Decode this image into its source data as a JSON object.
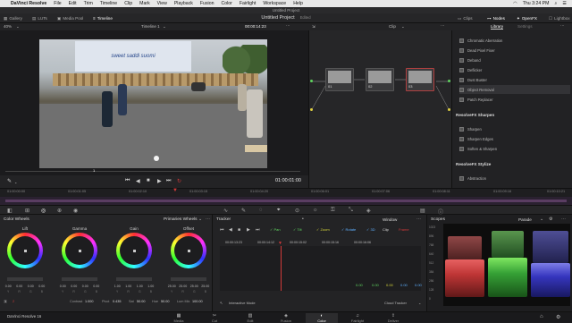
{
  "menubar": {
    "app": "DaVinci Resolve",
    "items": [
      "File",
      "Edit",
      "Trim",
      "Timeline",
      "Clip",
      "Mark",
      "View",
      "Playback",
      "Fusion",
      "Color",
      "Fairlight",
      "Workspace",
      "Help"
    ],
    "clock": "Thu 3:24 PM"
  },
  "window": {
    "title": "Untitled Project"
  },
  "toptabs": {
    "gallery": "Gallery",
    "luts": "LUTs",
    "media_pool": "Media Pool",
    "timeline": "Timeline",
    "clips": "Clips",
    "nodes": "Nodes",
    "openfx": "OpenFX",
    "lightbox": "Lightbox"
  },
  "project": {
    "title": "Untitled Project",
    "status": "Edited"
  },
  "viewer": {
    "zoom": "40%",
    "timeline_name": "Timeline 1",
    "header_timecode": "00:00:14:23",
    "clip_label": "Clip",
    "timecode": "01:00:01:00",
    "marker": "1",
    "screen_text": "sweet saddi suomi"
  },
  "nodes": {
    "n1": "01",
    "n2": "02",
    "n3": "03"
  },
  "library": {
    "tab": "Library",
    "settings": "Settings",
    "items_a": [
      "Chromatic Aberration",
      "Dead Pixel Fixer",
      "Deband",
      "Deflicker",
      "Dust Buster",
      "Object Removal",
      "Patch Replacer"
    ],
    "head_sharpen": "ResolveFX Sharpen",
    "items_b": [
      "Sharpen",
      "Sharpen Edges",
      "Soften & Sharpen"
    ],
    "head_stylize": "ResolveFX Stylize",
    "items_c": [
      "Abstraction"
    ]
  },
  "ruler": {
    "ticks": [
      "01:00:00:00",
      "01:00:01:05",
      "01:00:02:10",
      "01:00:03:15",
      "01:00:04:20",
      "01:00:06:01",
      "01:00:07:06",
      "01:00:08:11",
      "01:00:09:16",
      "01:00:10:21"
    ]
  },
  "wheels": {
    "title": "Color Wheels",
    "mode": "Primaries Wheels",
    "lift": {
      "label": "Lift",
      "vals": [
        "0.00",
        "0.00",
        "0.00",
        "0.00"
      ]
    },
    "gamma": {
      "label": "Gamma",
      "vals": [
        "0.00",
        "0.00",
        "0.00",
        "0.00"
      ]
    },
    "gain": {
      "label": "Gain",
      "vals": [
        "1.00",
        "1.00",
        "1.00",
        "1.00"
      ]
    },
    "offset": {
      "label": "Offset",
      "vals": [
        "25.00",
        "25.00",
        "25.00",
        "25.00"
      ]
    },
    "sub": [
      "Y",
      "R",
      "G",
      "B"
    ],
    "contrast_label": "Contrast",
    "contrast": "1.000",
    "pivot_label": "Pivot",
    "pivot": "0.435",
    "sat_label": "Sat",
    "sat": "50.00",
    "hue_label": "Hue",
    "hue": "50.00",
    "lummix_label": "Lum Mix",
    "lummix": "100.00"
  },
  "tracker": {
    "title": "Tracker",
    "window": "Window",
    "clip": "Clip",
    "frame": "Frame",
    "options": [
      "Pan",
      "Tilt",
      "Zoom",
      "Rotate",
      "3D"
    ],
    "times": [
      "00:00:13:23",
      "00:00:14:12",
      "00:00:15:02",
      "00:00:15:16",
      "00:00:16:06"
    ],
    "vals": [
      "0.00",
      "0.00",
      "0.00",
      "0.00",
      "0.00"
    ],
    "mode": "Interactive Mode",
    "tracker_type": "Cloud Tracker"
  },
  "scopes": {
    "title": "Scopes",
    "type": "Parade",
    "scale": [
      "1023",
      "896",
      "768",
      "640",
      "512",
      "384",
      "256",
      "128",
      "0"
    ]
  },
  "pages": {
    "app_name": "DaVinci Resolve 16",
    "items": [
      "Media",
      "Cut",
      "Edit",
      "Fusion",
      "Color",
      "Fairlight",
      "Deliver"
    ],
    "active": "Color"
  },
  "colors": {
    "accent": "#d23a3a",
    "active_tab": "#ffffff"
  }
}
